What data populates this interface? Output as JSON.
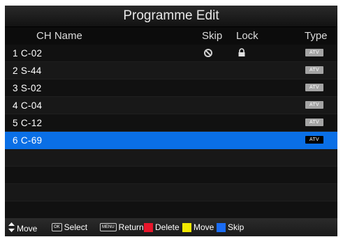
{
  "title": "Programme Edit",
  "columns": {
    "name": "CH Name",
    "skip": "Skip",
    "lock": "Lock",
    "type": "Type"
  },
  "channels": [
    {
      "label": "1 C-02",
      "type": "ATV",
      "skip_icon": "skip-icon",
      "lock_icon": "lock-icon"
    },
    {
      "label": "2 S-44",
      "type": "ATV"
    },
    {
      "label": "3 S-02",
      "type": "ATV"
    },
    {
      "label": "4 C-04",
      "type": "ATV"
    },
    {
      "label": "5 C-12",
      "type": "ATV"
    },
    {
      "label": "6 C-69",
      "type": "ATV",
      "selected": true
    }
  ],
  "footer": {
    "move_icon": "up-down-arrow-icon",
    "move_label": "Move",
    "ok_key": "OK",
    "select_label": "Select",
    "menu_key": "MENU",
    "return_label": "Return",
    "delete_label": "Delete",
    "delete_color": "#e8162b",
    "move2_label": "Move",
    "move2_color": "#f2e800",
    "skip_label": "Skip",
    "skip_color": "#1a6cf5"
  },
  "colors": {
    "selected_row": "#0a6fe6",
    "background": "#141414"
  }
}
